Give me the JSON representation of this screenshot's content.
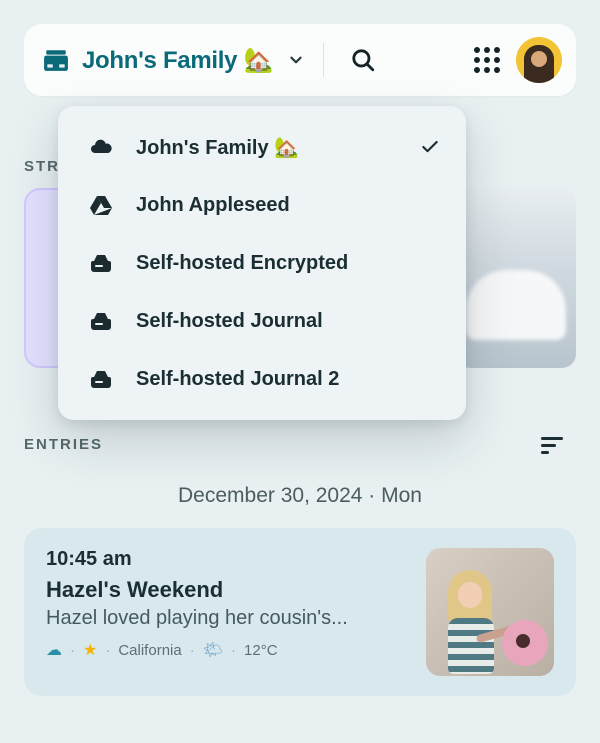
{
  "header": {
    "selected_journal": "John's Family 🏡"
  },
  "dropdown": {
    "items": [
      {
        "label": "John's Family 🏡",
        "icon": "cloud",
        "selected": true
      },
      {
        "label": "John Appleseed",
        "icon": "drive",
        "selected": false
      },
      {
        "label": "Self-hosted Encrypted",
        "icon": "server",
        "selected": false
      },
      {
        "label": "Self-hosted Journal",
        "icon": "server",
        "selected": false
      },
      {
        "label": "Self-hosted Journal 2",
        "icon": "server",
        "selected": false
      }
    ]
  },
  "sections": {
    "streaks": "STREAKS",
    "entries": "ENTRIES"
  },
  "date_header": "December 30, 2024 · Mon",
  "entry": {
    "time": "10:45 am",
    "title": "Hazel's Weekend",
    "snippet": "Hazel loved playing her cousin's...",
    "location": "California",
    "temperature": "12°C"
  }
}
